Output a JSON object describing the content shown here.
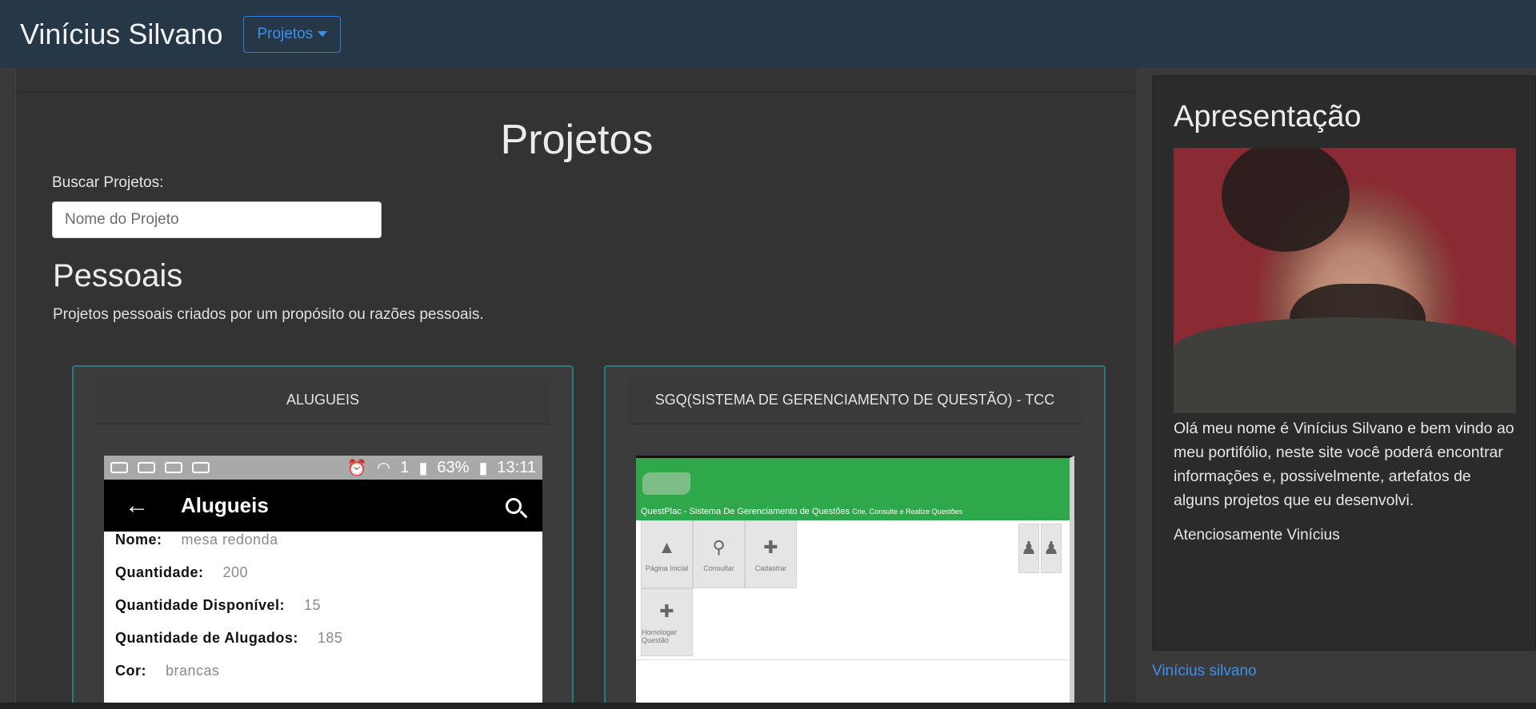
{
  "navbar": {
    "brand": "Vinícius Silvano",
    "dropdown_label": "Projetos"
  },
  "main": {
    "title": "Projetos",
    "search": {
      "label": "Buscar Projetos:",
      "placeholder": "Nome do Projeto",
      "value": ""
    },
    "section": {
      "title": "Pessoais",
      "description": "Projetos pessoais criados por um propósito ou razões pessoais."
    },
    "cards": [
      {
        "title": "ALUGUEIS",
        "screenshot": {
          "status": {
            "battery": "63%",
            "time": "13:11",
            "sim": "1"
          },
          "app_title": "Alugueis",
          "fields": [
            {
              "label": "Nome:",
              "value": "mesa redonda"
            },
            {
              "label": "Quantidade:",
              "value": "200"
            },
            {
              "label": "Quantidade Disponível:",
              "value": "15"
            },
            {
              "label": "Quantidade de Alugados:",
              "value": "185"
            },
            {
              "label": "Cor:",
              "value": "brancas"
            }
          ]
        }
      },
      {
        "title": "SGQ(SISTEMA DE GERENCIAMENTO DE QUESTÃO) - TCC",
        "screenshot": {
          "header": "QuestPlac - Sistema De Gerenciamento de Questões",
          "header_sub": "Crie, Consulte e Realize Questões",
          "tools": [
            "Página Inicial",
            "Consultar",
            "Cadastrar",
            "Homologar Questão"
          ]
        }
      }
    ]
  },
  "sidebar": {
    "title": "Apresentação",
    "bio": "Olá meu nome é Vinícius Silvano e bem vindo ao meu portifólio, neste site você poderá encontrar informações e, possivelmente, artefatos de alguns projetos que eu desenvolvi.",
    "signoff": "Atenciosamente Vinícius"
  },
  "footer": {
    "link": "Vinícius silvano"
  },
  "colors": {
    "navbar": "#263848",
    "link": "#3a91ef",
    "card_border": "#2a7a7a",
    "app_green": "#2ea84a"
  }
}
